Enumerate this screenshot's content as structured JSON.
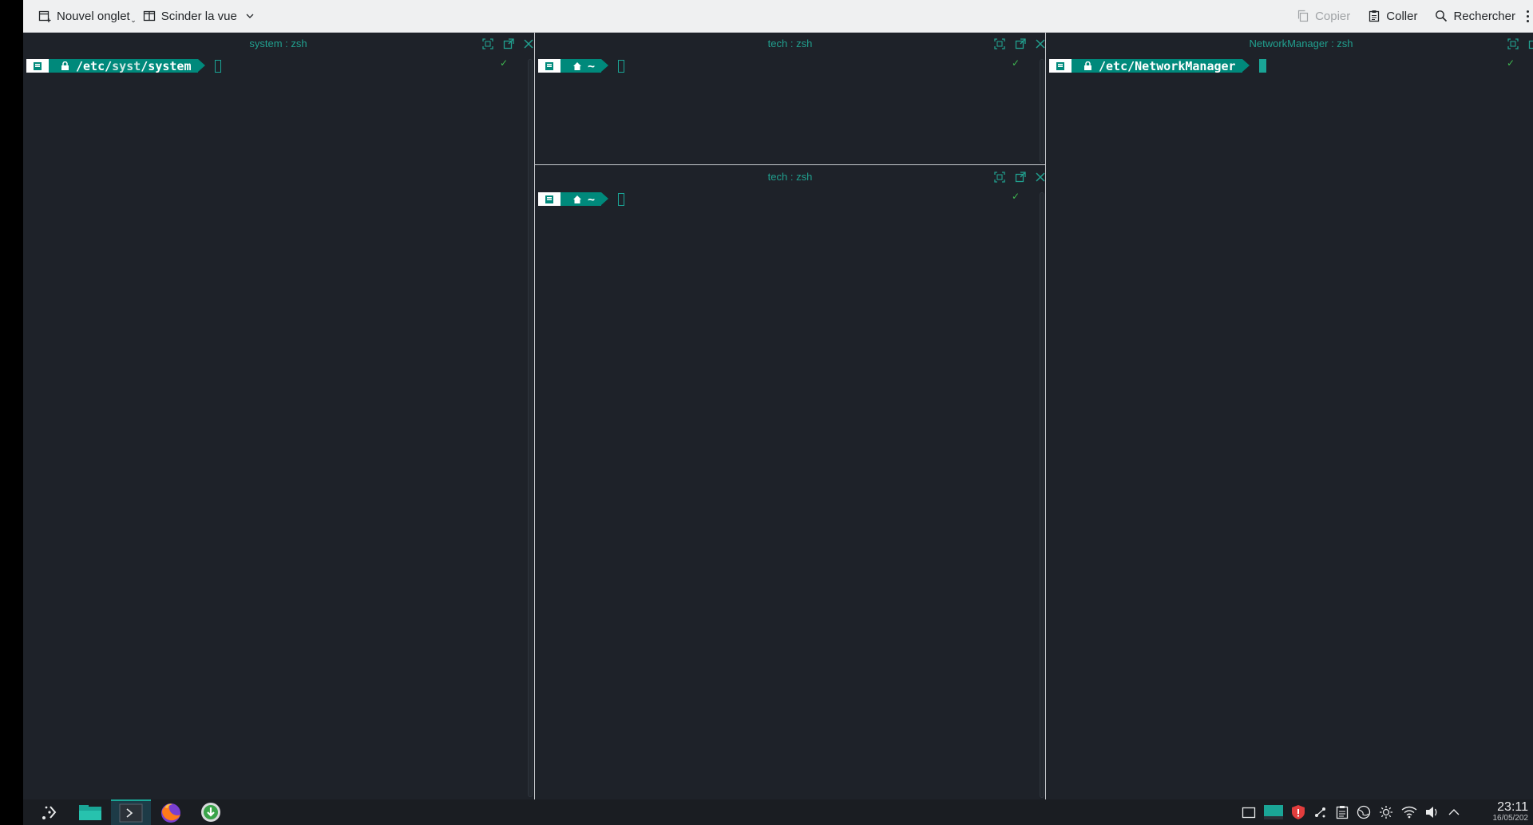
{
  "toolbar": {
    "new_tab_label": "Nouvel onglet",
    "split_view_label": "Scinder la vue",
    "copy_label": "Copier",
    "paste_label": "Coller",
    "search_label": "Rechercher"
  },
  "panes": {
    "left": {
      "title": "system : zsh",
      "path_a": "/etc/",
      "path_b": "syst",
      "path_c": "/system"
    },
    "middle_top": {
      "title": "tech : zsh",
      "path": "~"
    },
    "middle_bottom": {
      "title": "tech : zsh",
      "path": "~"
    },
    "right": {
      "title": "NetworkManager : zsh",
      "path": "/etc/NetworkManager"
    }
  },
  "status": {
    "check": "✓"
  },
  "clock": {
    "time": "23:11",
    "date": "16/05/202"
  },
  "colors": {
    "accent": "#1aa596",
    "prompt_bg": "#00897b",
    "terminal_bg": "#1e2229",
    "title_text": "#21a08f"
  },
  "taskbar": {
    "icons": [
      "app-launcher-icon",
      "file-manager-icon",
      "konsole-icon",
      "firefox-icon",
      "download-icon"
    ],
    "tray_icons": [
      "show-desktop-icon",
      "virtual-desktop-icon",
      "security-icon",
      "kde-connect-icon",
      "clipboard-icon",
      "network-globe-icon",
      "brightness-icon",
      "wifi-icon",
      "volume-icon",
      "expand-tray-icon"
    ]
  }
}
